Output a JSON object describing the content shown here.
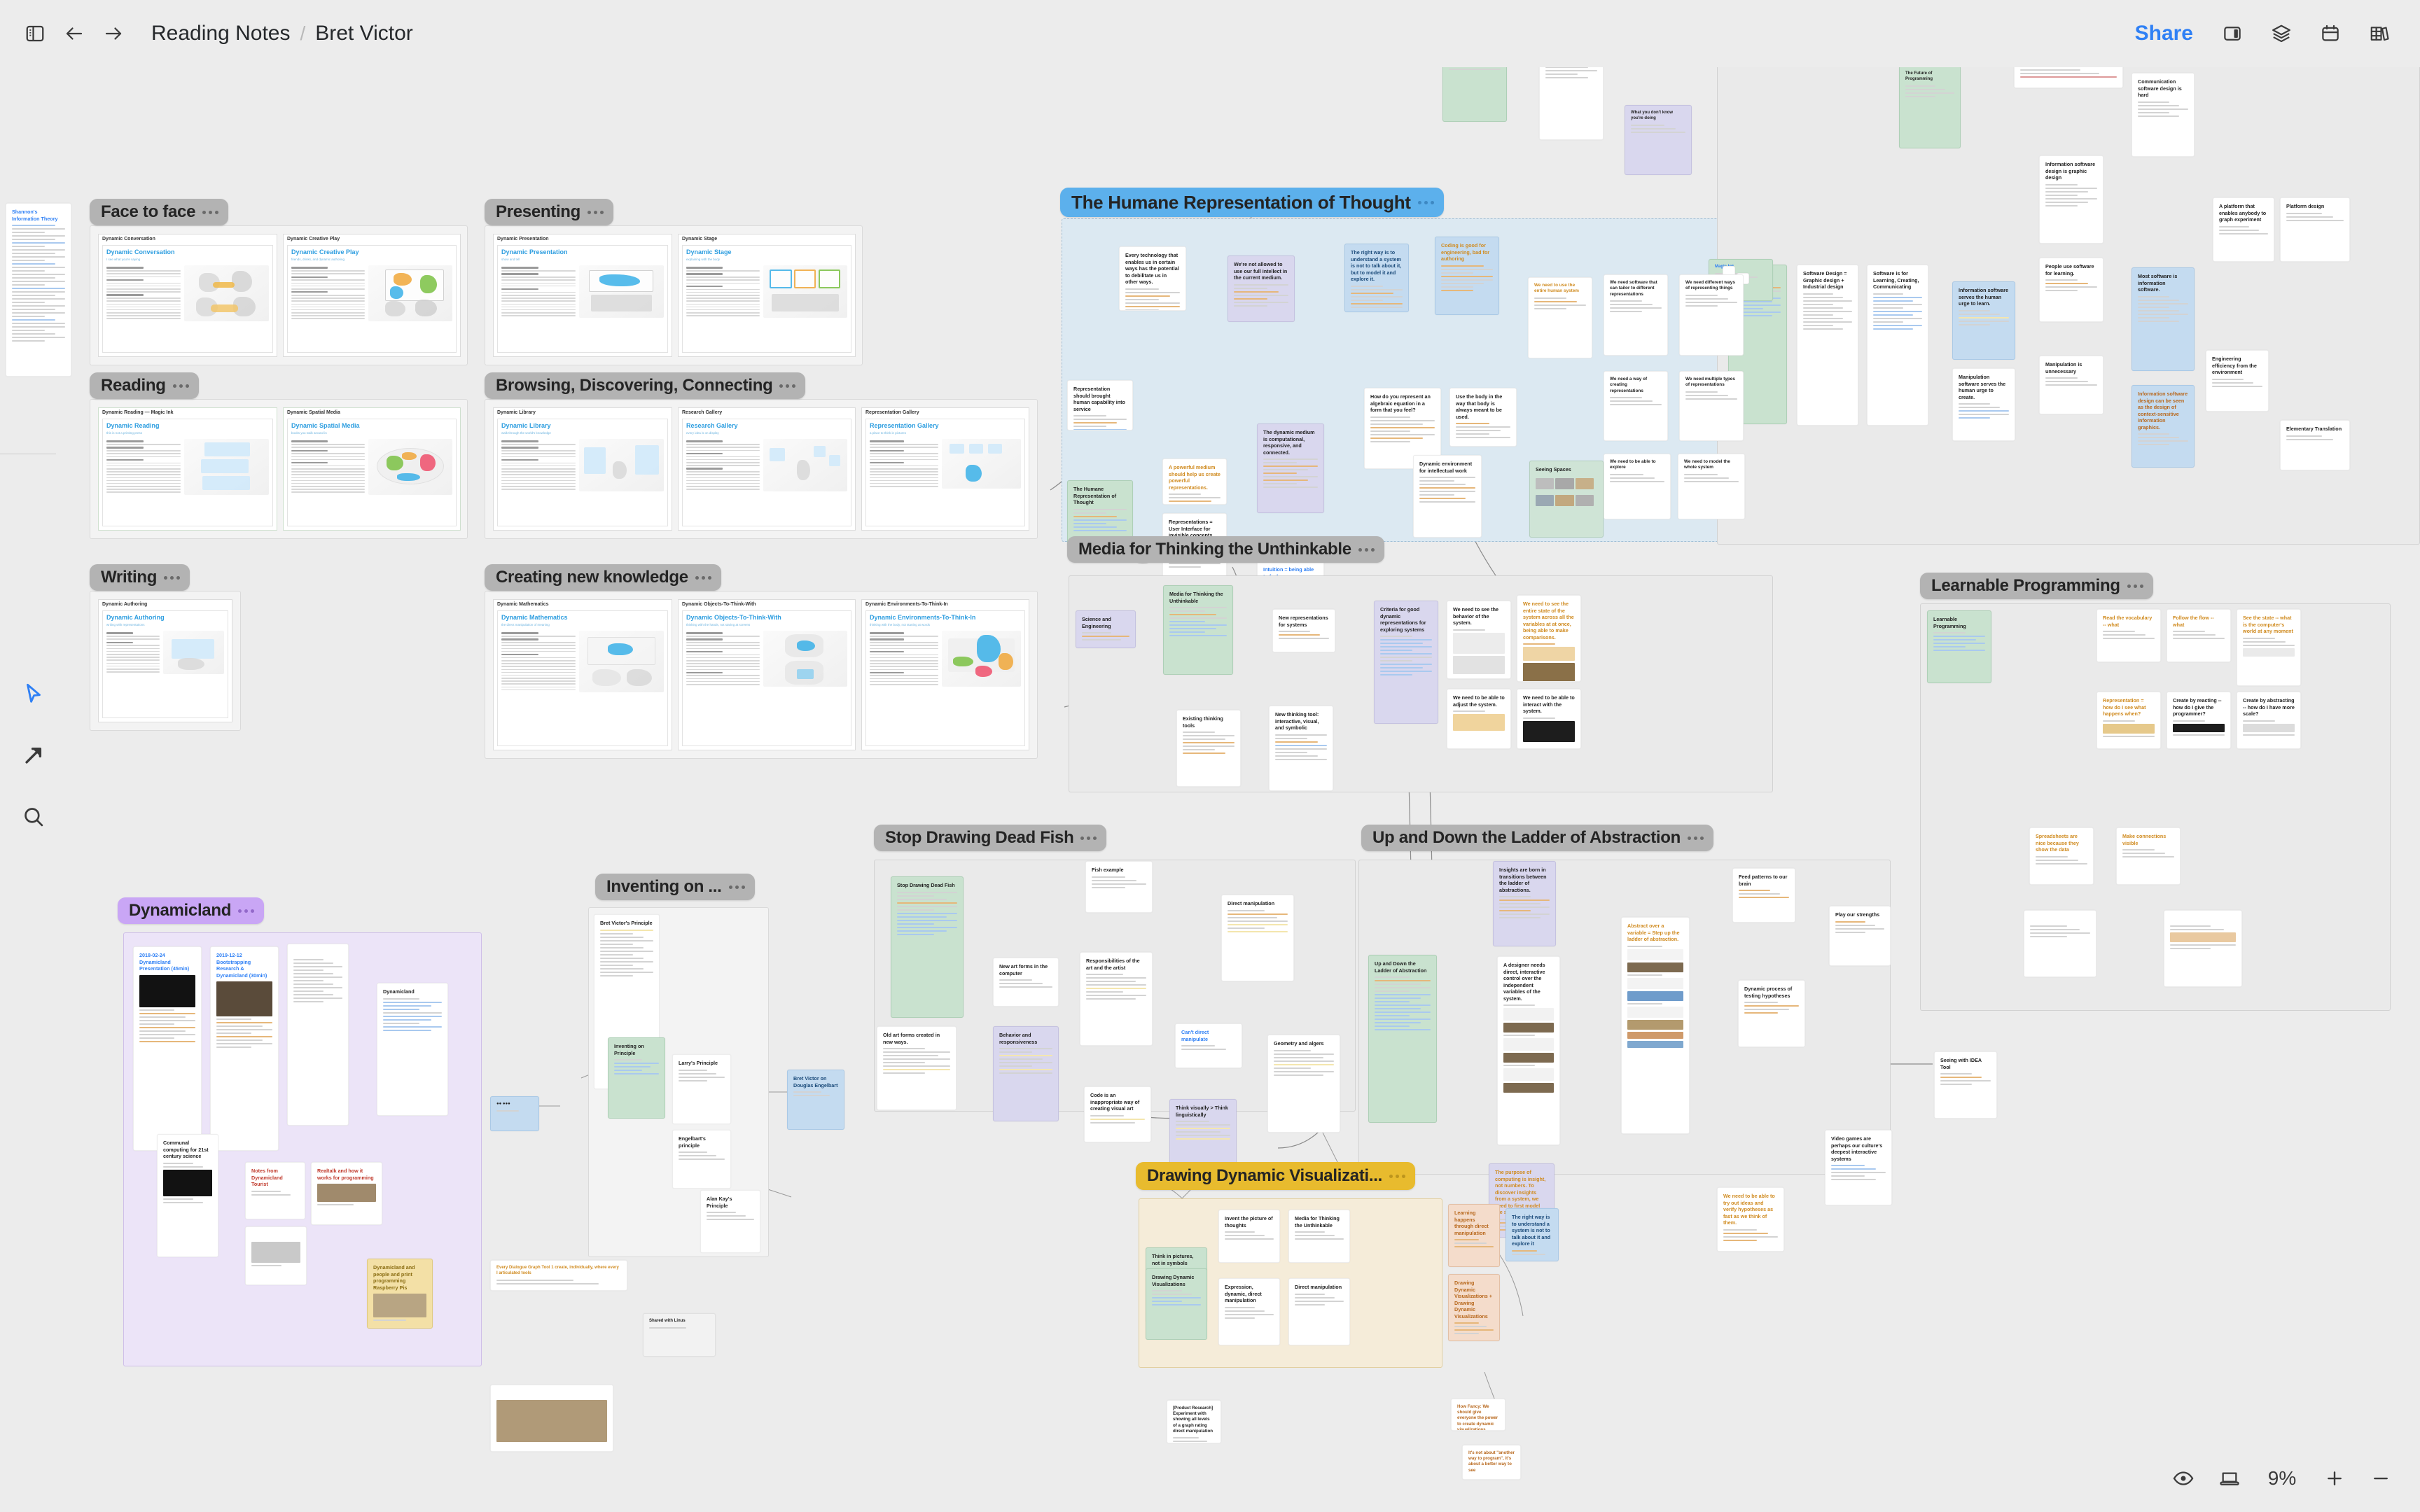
{
  "app": {
    "zoom_level": "9%",
    "accent_color": "#2f80f5"
  },
  "header": {
    "sidebar_toggle_icon": "sidebar-toggle-icon",
    "back_icon": "arrow-left-icon",
    "forward_icon": "arrow-right-icon",
    "breadcrumb": {
      "root": "Reading Notes",
      "separator": "/",
      "current": "Bret Victor"
    },
    "share_label": "Share",
    "right_icons": [
      "right-panel-icon",
      "layers-icon",
      "calendar-icon",
      "library-icon"
    ]
  },
  "toolbar": {
    "tools": [
      {
        "name": "select-tool",
        "icon": "cursor-icon",
        "active": true
      },
      {
        "name": "connector-tool",
        "icon": "arrow-diagonal-icon",
        "active": false
      },
      {
        "name": "search-tool",
        "icon": "search-icon",
        "active": false
      }
    ]
  },
  "footer": {
    "eye_icon": "eye-icon",
    "present_icon": "laptop-icon",
    "zoom_level": "9%",
    "zoom_in": "+",
    "zoom_out": "−"
  },
  "sections": [
    {
      "id": "face-to-face",
      "label": "Face to face",
      "color": "#b3b3b3"
    },
    {
      "id": "reading",
      "label": "Reading",
      "color": "#b3b3b3"
    },
    {
      "id": "writing",
      "label": "Writing",
      "color": "#b3b3b3"
    },
    {
      "id": "presenting",
      "label": "Presenting",
      "color": "#b3b3b3"
    },
    {
      "id": "browsing",
      "label": "Browsing, Discovering, Connecting",
      "color": "#b3b3b3"
    },
    {
      "id": "creating",
      "label": "Creating new knowledge",
      "color": "#b3b3b3"
    },
    {
      "id": "humane",
      "label": "The Humane Representation of Thought",
      "color": "#5cb0ec"
    },
    {
      "id": "media",
      "label": "Media for Thinking the Unthinkable",
      "color": "#b3b3b3"
    },
    {
      "id": "learnable",
      "label": "Learnable Programming",
      "color": "#b3b3b3"
    },
    {
      "id": "deadfish",
      "label": "Stop Drawing Dead Fish",
      "color": "#b3b3b3"
    },
    {
      "id": "ladder",
      "label": "Up and Down the Ladder of Abstraction",
      "color": "#b3b3b3"
    },
    {
      "id": "dynamicland",
      "label": "Dynamicland",
      "color": "#c9a6f5"
    },
    {
      "id": "inventing",
      "label": "Inventing on ...",
      "color": "#b3b3b3"
    },
    {
      "id": "drawingdv",
      "label": "Drawing Dynamic Visualizati...",
      "color": "#e8bb2e"
    }
  ],
  "documents": {
    "face_to_face": [
      {
        "header": "Dynamic Conversation",
        "title": "Dynamic Conversation",
        "subtitle": "I see what you're saying"
      },
      {
        "header": "Dynamic Creative Play",
        "title": "Dynamic Creative Play",
        "subtitle": "friends, drinks, and dynamic authoring"
      }
    ],
    "reading": [
      {
        "header": "Dynamic Reading — Magic Ink",
        "title": "Dynamic Reading",
        "subtitle": "this is not a printing press"
      },
      {
        "header": "Dynamic Spatial Media",
        "title": "Dynamic Spatial Media",
        "subtitle": "books you walk around in"
      }
    ],
    "writing": [
      {
        "header": "Dynamic Authoring",
        "title": "Dynamic Authoring",
        "subtitle": "writing with representations"
      }
    ],
    "presenting": [
      {
        "header": "Dynamic Presentation",
        "title": "Dynamic Presentation",
        "subtitle": "show and tell"
      },
      {
        "header": "Dynamic Stage",
        "title": "Dynamic Stage",
        "subtitle": "explaining with the body"
      }
    ],
    "browsing": [
      {
        "header": "Dynamic Library",
        "title": "Dynamic Library",
        "subtitle": "walk through the world's knowledge"
      },
      {
        "header": "Research Gallery",
        "title": "Research Gallery",
        "subtitle": "every idea is on display"
      },
      {
        "header": "Representation Gallery",
        "title": "Representation Gallery",
        "subtitle": "a place to think in pictures"
      }
    ],
    "creating": [
      {
        "header": "Dynamic Mathematics",
        "title": "Dynamic Mathematics",
        "subtitle": "the direct manipulation of meaning"
      },
      {
        "header": "Dynamic Objects-To-Think-With",
        "title": "Dynamic Objects-To-Think-With",
        "subtitle": "thinking with the hands, not staring at screens"
      },
      {
        "header": "Dynamic Environments-To-Think-In",
        "title": "Dynamic Environments-To-Think-In",
        "subtitle": "thinking with the body, not starting at words"
      }
    ]
  },
  "notes": {
    "humane": [
      {
        "title": "Every technology that enables us in certain ways has the potential to debilitate us in other ways.",
        "color": "white"
      },
      {
        "title": "We're not allowed to use our full intellect in the current medium.",
        "color": "purple"
      },
      {
        "title": "The right way is to understand a system is not to talk about it, but to model it and explore it.",
        "color": "blue"
      },
      {
        "title": "Coding is good for engineering, bad for authoring",
        "color": "blue"
      },
      {
        "title": "Representation should brought human capability into service",
        "color": "white"
      },
      {
        "title": "The Humane Representation of Thought",
        "color": "green"
      },
      {
        "title": "A powerful medium should help us create powerful representations.",
        "color": "white"
      },
      {
        "title": "Representations = User Interface for invisible concepts",
        "color": "white"
      },
      {
        "title": "The dynamic medium is computational, responsive, and connected.",
        "color": "purple"
      },
      {
        "title": "Intuition = being able to feel your way around a problem space",
        "color": "white"
      },
      {
        "title": "How do you represent an algebraic equation in a form that you feel?",
        "color": "white"
      },
      {
        "title": "Use the body in the way that body is always meant to be used.",
        "color": "white"
      },
      {
        "title": "Dynamic environment for intellectual work",
        "color": "white"
      },
      {
        "title": "Seeing Spaces",
        "color": "green"
      }
    ],
    "media": [
      {
        "title": "Science and Engineering",
        "color": "purple"
      },
      {
        "title": "Media for Thinking the Unthinkable",
        "color": "green"
      },
      {
        "title": "New representations for systems",
        "color": "white"
      },
      {
        "title": "Existing thinking tools",
        "color": "white"
      },
      {
        "title": "New thinking tool: interactive, visual, and symbolic",
        "color": "white"
      },
      {
        "title": "Criteria for good dynamic representations for exploring systems",
        "color": "purple"
      },
      {
        "title": "We need to see the behavior of the system.",
        "color": "white"
      },
      {
        "title": "We need to see the entire state of the system across all the variables at at once, being able to make comparisons.",
        "color": "white"
      },
      {
        "title": "We need to be able to adjust the system.",
        "color": "white"
      },
      {
        "title": "We need to be able to interact with the system.",
        "color": "white"
      }
    ],
    "deadfish": [
      {
        "title": "Stop Drawing Dead Fish",
        "color": "green"
      },
      {
        "title": "Old art forms created in new ways.",
        "color": "white"
      },
      {
        "title": "New art forms in the computer",
        "color": "white"
      },
      {
        "title": "Behavior and responsiveness",
        "color": "purple"
      },
      {
        "title": "Fish example",
        "color": "white"
      },
      {
        "title": "Responsibilities of the art and the artist",
        "color": "white"
      },
      {
        "title": "Code is an inappropriate way of creating visual art",
        "color": "white"
      },
      {
        "title": "Direct manipulation",
        "color": "white"
      },
      {
        "title": "Can't direct manipulate",
        "color": "white"
      },
      {
        "title": "Think visually > Think linguistically",
        "color": "purple"
      },
      {
        "title": "Geometry and algers",
        "color": "white"
      }
    ],
    "ladder": [
      {
        "title": "Up and Down the Ladder of Abstraction",
        "color": "green"
      },
      {
        "title": "Insights are born in transitions between the ladder of abstractions.",
        "color": "purple"
      },
      {
        "title": "A designer needs direct, interactive control over the independent variables of the system.",
        "color": "white"
      },
      {
        "title": "Abstract over a variable = Step up the ladder of abstraction.",
        "color": "white"
      },
      {
        "title": "Feed patterns to our brain",
        "color": "white"
      },
      {
        "title": "Play our strengths",
        "color": "white"
      },
      {
        "title": "Dynamic process of testing hypotheses",
        "color": "white"
      },
      {
        "title": "The purpose of computing is insight, not numbers. To discover insights from a system, we need to first model the system.",
        "color": "purple"
      },
      {
        "title": "We need to be able to try out ideas and verify hypotheses as fast as we think of them.",
        "color": "white"
      },
      {
        "title": "Video games are perhaps our culture's deepest interactive systems",
        "color": "white"
      },
      {
        "title": "Seeing with IDEA Tool",
        "color": "white"
      }
    ],
    "learnable": [
      {
        "title": "Learnable Programming",
        "color": "green"
      },
      {
        "title": "Read the vocabulary -- what",
        "color": "white"
      },
      {
        "title": "Follow the flow -- what",
        "color": "white"
      },
      {
        "title": "See the state -- what is the computer's world at any moment",
        "color": "white"
      },
      {
        "title": "Representation = how do I see what happens when?",
        "color": "white"
      },
      {
        "title": "Create by reacting -- how do I give the programmer?",
        "color": "white"
      },
      {
        "title": "Create by abstracting -- how do I have more scale?",
        "color": "white"
      },
      {
        "title": "Spreadsheets are nice because they show the data",
        "color": "white"
      },
      {
        "title": "Make connections visible",
        "color": "white"
      }
    ],
    "drawingdv": [
      {
        "title": "Think in pictures, not in symbols",
        "color": "white"
      },
      {
        "title": "Invent the picture of thoughts",
        "color": "white"
      },
      {
        "title": "Media for Thinking the Unthinkable",
        "color": "white"
      },
      {
        "title": "Drawing Dynamic Visualizations",
        "color": "green"
      },
      {
        "title": "Expression, dynamic, direct manipulation",
        "color": "white"
      },
      {
        "title": "Direct manipulation",
        "color": "white"
      },
      {
        "title": "Learning happens through direct manipulation",
        "color": "orange"
      },
      {
        "title": "The right way is to understand a system is not to talk about it and explore it",
        "color": "blue"
      },
      {
        "title": "Drawing Dynamic Visualizations + Drawing Dynamic Visualizations",
        "color": "orange"
      },
      {
        "title": "How Fancy: We should give everyone the power to create dynamic visualizations",
        "color": "orange"
      },
      {
        "title": "It's not about \"another way to program\", it's about a better way to see",
        "color": "orange"
      },
      {
        "title": "[Product Research] Experiment with showing all levels of a graph rating direct manipulation",
        "color": "white"
      }
    ],
    "magicink": [
      {
        "title": "Magic Ink",
        "color": "green"
      },
      {
        "title": "Software Design = Graphic design + Industrial design",
        "color": "white"
      },
      {
        "title": "Software is for Learning, Creating, Communicating",
        "color": "white"
      },
      {
        "title": "Information software serves the human urge to learn.",
        "color": "blue"
      },
      {
        "title": "Manipulation software serves the human urge to create.",
        "color": "white"
      },
      {
        "title": "Information software design is graphic design",
        "color": "white"
      },
      {
        "title": "People use software for learning.",
        "color": "white"
      },
      {
        "title": "Manipulation is unnecessary",
        "color": "white"
      },
      {
        "title": "Most software is information software.",
        "color": "blue"
      },
      {
        "title": "Information software design can be seen as the design of context-sensitive information graphics.",
        "color": "blue"
      },
      {
        "title": "Communication software design is hard",
        "color": "white"
      },
      {
        "title": "Engineering efficiency from the environment",
        "color": "white"
      },
      {
        "title": "A platform that enables anybody to graph experiment",
        "color": "white"
      },
      {
        "title": "Platform design",
        "color": "white"
      },
      {
        "title": "Elementary Translation",
        "color": "white"
      }
    ],
    "dynamicland": [
      {
        "title": "2018-02-24 Dynamicland Presentation (45min)",
        "color": "white"
      },
      {
        "title": "2019-12-12 Bootstrapping Research & Dynamicland (30min)",
        "color": "white"
      },
      {
        "title": "Dynamicland",
        "color": "white"
      },
      {
        "title": "Communal computing for 21st century science",
        "color": "white"
      },
      {
        "title": "Notes from Dynamicland Tourist",
        "color": "white"
      },
      {
        "title": "Realtalk and how it works for programming",
        "color": "orange"
      },
      {
        "title": "Dynamicland and people and print programming Raspberry Pis",
        "color": "white"
      }
    ],
    "inventing": [
      {
        "title": "Bret Victor's Principle",
        "color": "white"
      },
      {
        "title": "Inventing on Principle",
        "color": "green"
      },
      {
        "title": "Larry's Principle",
        "color": "white"
      },
      {
        "title": "Engelbart's principle",
        "color": "white"
      },
      {
        "title": "Alan Kay's Principle",
        "color": "white"
      },
      {
        "title": "Bret Victor on Douglas Engelbart",
        "color": "white"
      }
    ],
    "left_edge": [
      {
        "title": "Shannon's Information Theory",
        "color": "white"
      }
    ]
  }
}
